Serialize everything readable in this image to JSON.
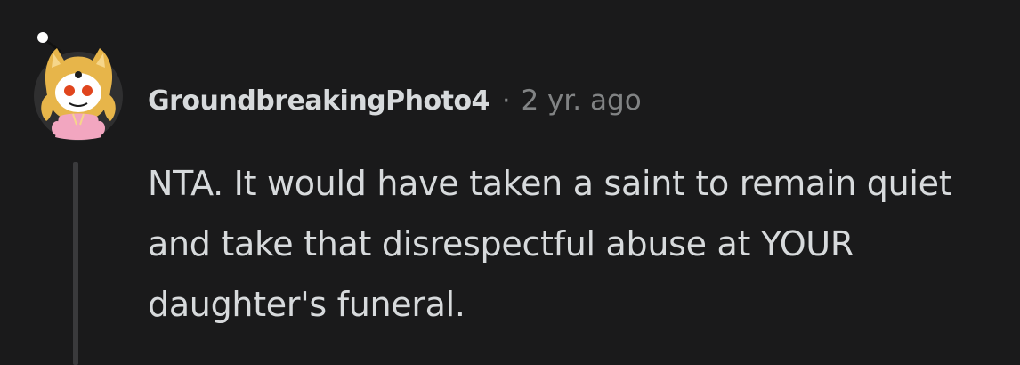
{
  "comment": {
    "author": "GroundbreakingPhoto4",
    "separator": "·",
    "timestamp": "2 yr. ago",
    "avatar_icon": "snoo-avatar-icon",
    "body": "NTA. It would have taken a saint to remain quiet and take that disrespectful abuse at YOUR daughter's funeral."
  },
  "colors": {
    "background": "#1a1a1b",
    "text": "#d7dadc",
    "muted": "#818384",
    "thread_line": "#3a3a3c"
  }
}
